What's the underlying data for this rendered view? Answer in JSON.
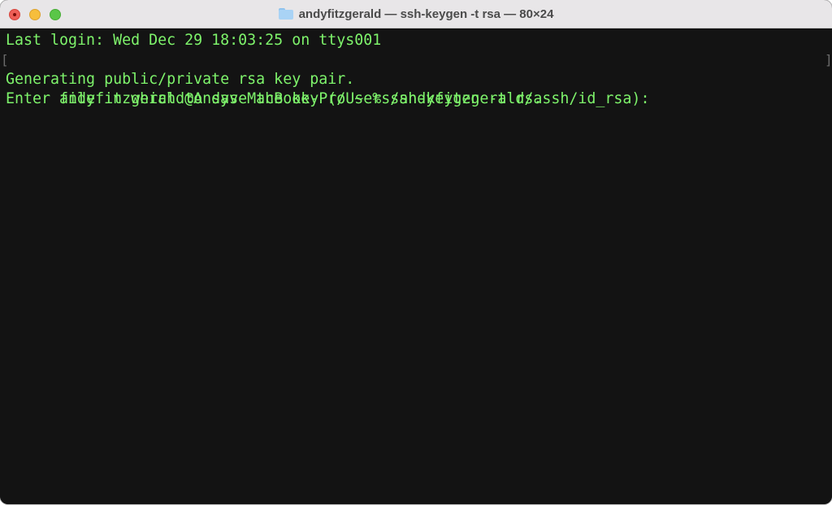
{
  "window": {
    "title": "andyfitzgerald — ssh-keygen -t rsa — 80×24",
    "buttons": {
      "close": "close",
      "minimize": "minimize",
      "zoom": "zoom"
    },
    "title_icon": "folder-icon"
  },
  "terminal": {
    "lines": [
      "Last login: Wed Dec 29 18:03:25 on ttys001",
      "andyfitzgerald@Andys-MacBook-Pro ~ % ssh-keygen -t rsa",
      "Generating public/private rsa key pair.",
      "Enter file in which to save the key (/Users/andyfitzgerald/.ssh/id_rsa):"
    ],
    "mark_left": "[",
    "mark_right": "]",
    "text_color": "#7ef36b",
    "background_color": "#131313"
  }
}
